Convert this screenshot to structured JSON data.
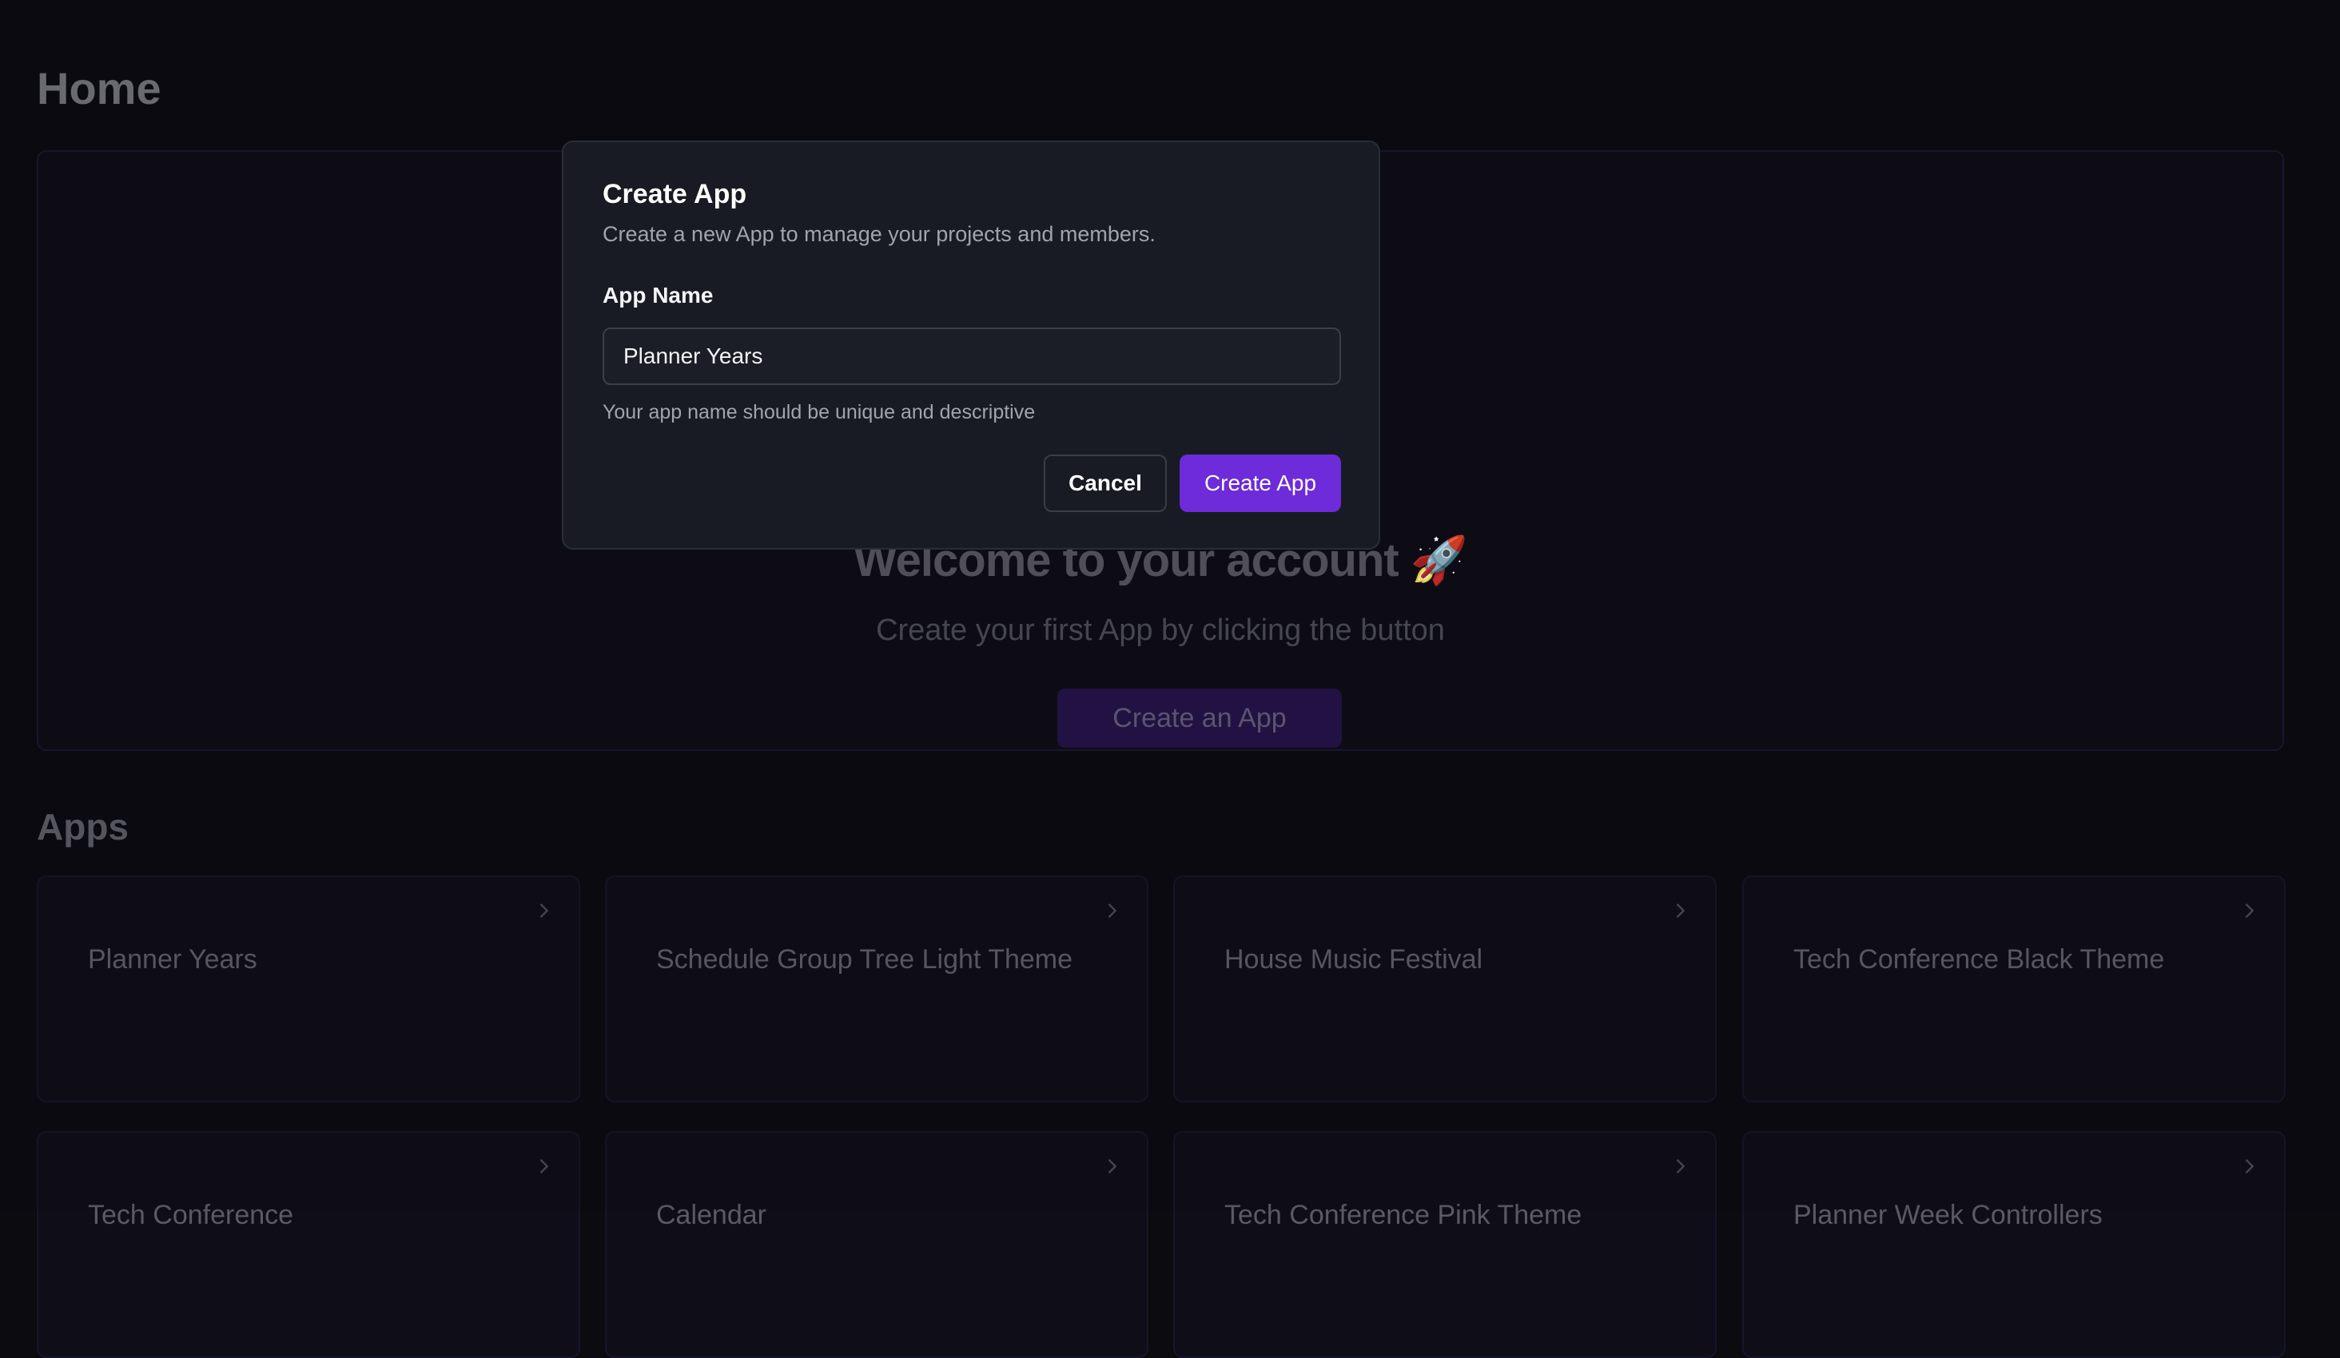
{
  "page": {
    "title": "Home",
    "hero": {
      "heading": "Welcome to your account 🚀",
      "subtitle": "Create your first App by clicking the button",
      "button_label": "Create an App"
    },
    "apps_title": "Apps",
    "apps": [
      {
        "name": "Planner Years"
      },
      {
        "name": "Schedule Group Tree Light Theme"
      },
      {
        "name": "House Music Festival"
      },
      {
        "name": "Tech Conference Black Theme"
      },
      {
        "name": "Tech Conference"
      },
      {
        "name": "Calendar"
      },
      {
        "name": "Tech Conference Pink Theme"
      },
      {
        "name": "Planner Week Controllers"
      }
    ]
  },
  "modal": {
    "title": "Create App",
    "description": "Create a new App to manage your projects and members.",
    "field_label": "App Name",
    "field_value": "Planner Years",
    "field_help": "Your app name should be unique and descriptive",
    "cancel_label": "Cancel",
    "submit_label": "Create App"
  },
  "colors": {
    "accent": "#6d2bd9",
    "modal_bg": "#181b23",
    "page_bg": "#0c0b12"
  },
  "icons": {
    "card_chevron": "chevron-right-icon"
  }
}
